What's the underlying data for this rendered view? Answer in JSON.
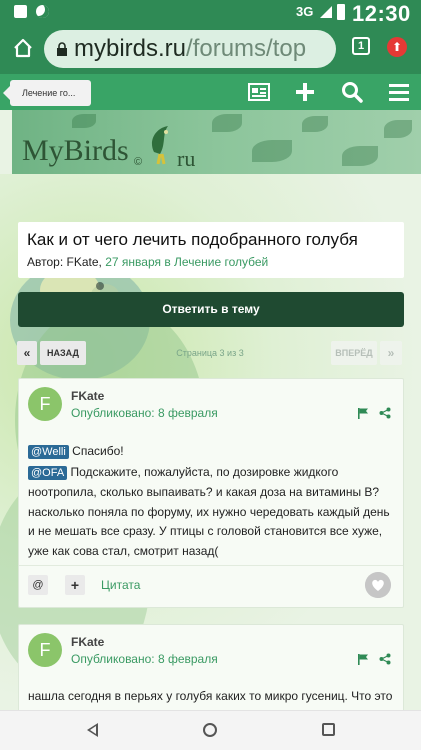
{
  "status_bar": {
    "network": "3G",
    "time": "12:30"
  },
  "browser": {
    "url_domain": "mybirds.ru",
    "url_path": "/forums/top",
    "tab_count": "1"
  },
  "site_toolbar": {
    "breadcrumb": "Лечение го...",
    "icons": [
      "news-icon",
      "plus-icon",
      "search-icon",
      "menu-icon"
    ]
  },
  "logo": {
    "name": "MyBirds",
    "copyright": "©",
    "tld": "ru"
  },
  "topic": {
    "title": "Как и от чего лечить подобранного голубя",
    "author_prefix": "Автор:",
    "author": "FKate,",
    "date": "27 января",
    "in_word": "в",
    "forum": "Лечение голубей"
  },
  "reply_button": "Ответить в тему",
  "pagination": {
    "first": "«",
    "prev": "НАЗАД",
    "info": "Страница 3 из 3",
    "next": "ВПЕРЁД",
    "last": "»"
  },
  "posts": [
    {
      "avatar_letter": "F",
      "author": "FKate",
      "published": "Опубликовано: 8 февраля",
      "mention_1": "@Welli",
      "text_1": "Спасибо!",
      "mention_2": "@OFA",
      "text_2": "Подскажите, пожалуйста, по дозировке жидкого ноотропила, сколько выпаивать? и какая доза на витамины В? насколько поняла по форуму, их нужно чередовать каждый день и не мешать все сразу. У птицы с головой становится все хуже, уже как сова стал, смотрит назад(",
      "actions": {
        "at": "@",
        "plus": "+",
        "quote": "Цитата"
      }
    },
    {
      "avatar_letter": "F",
      "author": "FKate",
      "published": "Опубликовано: 8 февраля",
      "text": "нашла сегодня в перьях у голубя каких то микро гусениц. Что это"
    }
  ],
  "colors": {
    "status_bar": "#2f8a55",
    "toolbar": "#39a466",
    "reply_button": "#1f4a31",
    "link": "#3a9a63",
    "mention": "#2b6a96"
  }
}
